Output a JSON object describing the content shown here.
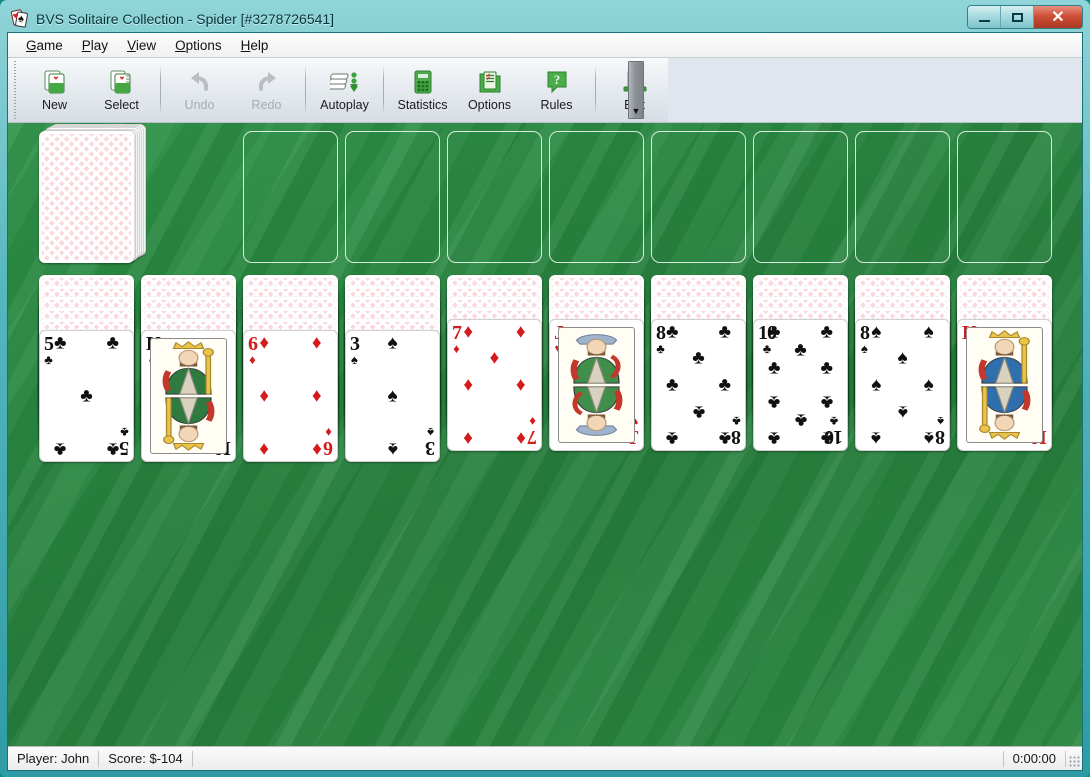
{
  "window": {
    "title": "BVS Solitaire Collection  -  Spider [#3278726541]",
    "app_icon": "cards-icon",
    "buttons": {
      "minimize": "minimize-icon",
      "maximize": "maximize-icon",
      "close": "✕"
    }
  },
  "menubar": {
    "items": [
      {
        "label": "Game",
        "accel": "G"
      },
      {
        "label": "Play",
        "accel": "P"
      },
      {
        "label": "View",
        "accel": "V"
      },
      {
        "label": "Options",
        "accel": "O"
      },
      {
        "label": "Help",
        "accel": "H"
      }
    ]
  },
  "toolbar": {
    "overflow_icon": "chevron-down-icon",
    "buttons": [
      {
        "label": "New",
        "icon": "new-game-icon",
        "enabled": true
      },
      {
        "label": "Select",
        "icon": "select-game-icon",
        "enabled": true
      },
      {
        "label": "Undo",
        "icon": "undo-icon",
        "enabled": false
      },
      {
        "label": "Redo",
        "icon": "redo-icon",
        "enabled": false
      },
      {
        "label": "Autoplay",
        "icon": "autoplay-icon",
        "enabled": true
      },
      {
        "label": "Statistics",
        "icon": "statistics-icon",
        "enabled": true
      },
      {
        "label": "Options",
        "icon": "options-icon",
        "enabled": true
      },
      {
        "label": "Rules",
        "icon": "rules-icon",
        "enabled": true
      },
      {
        "label": "Exit",
        "icon": "exit-icon",
        "enabled": true
      }
    ]
  },
  "table": {
    "felt_color": "#2a8a42",
    "stock": {
      "name": "stock-pile",
      "card_back": "pink-lattice",
      "visible_sheets": 7
    },
    "foundations": [
      {
        "name": "foundation-1",
        "empty": true
      },
      {
        "name": "foundation-2",
        "empty": true
      },
      {
        "name": "foundation-3",
        "empty": true
      },
      {
        "name": "foundation-4",
        "empty": true
      },
      {
        "name": "foundation-5",
        "empty": true
      },
      {
        "name": "foundation-6",
        "empty": true
      },
      {
        "name": "foundation-7",
        "empty": true
      },
      {
        "name": "foundation-8",
        "empty": true
      }
    ],
    "tableau": [
      {
        "column": 1,
        "facedown": 5,
        "top_card": {
          "rank": "5",
          "suit": "clubs",
          "suit_char": "♣",
          "color": "black",
          "court": false
        }
      },
      {
        "column": 2,
        "facedown": 5,
        "top_card": {
          "rank": "K",
          "suit": "clubs",
          "suit_char": "♣",
          "color": "black",
          "court": true
        }
      },
      {
        "column": 3,
        "facedown": 5,
        "top_card": {
          "rank": "6",
          "suit": "diamonds",
          "suit_char": "♦",
          "color": "red",
          "court": false
        }
      },
      {
        "column": 4,
        "facedown": 5,
        "top_card": {
          "rank": "3",
          "suit": "spades",
          "suit_char": "♠",
          "color": "black",
          "court": false
        }
      },
      {
        "column": 5,
        "facedown": 4,
        "top_card": {
          "rank": "7",
          "suit": "diamonds",
          "suit_char": "♦",
          "color": "red",
          "court": false
        }
      },
      {
        "column": 6,
        "facedown": 4,
        "top_card": {
          "rank": "J",
          "suit": "hearts",
          "suit_char": "♥",
          "color": "red",
          "court": true
        }
      },
      {
        "column": 7,
        "facedown": 4,
        "top_card": {
          "rank": "8",
          "suit": "clubs",
          "suit_char": "♣",
          "color": "black",
          "court": false
        }
      },
      {
        "column": 8,
        "facedown": 4,
        "top_card": {
          "rank": "10",
          "suit": "clubs",
          "suit_char": "♣",
          "color": "black",
          "court": false
        }
      },
      {
        "column": 9,
        "facedown": 4,
        "top_card": {
          "rank": "8",
          "suit": "spades",
          "suit_char": "♠",
          "color": "black",
          "court": false
        }
      },
      {
        "column": 10,
        "facedown": 4,
        "top_card": {
          "rank": "K",
          "suit": "diamonds",
          "suit_char": "♦",
          "color": "red",
          "court": true
        }
      }
    ]
  },
  "statusbar": {
    "player": "Player: John",
    "score": "Score: $-104",
    "timer": "0:00:00",
    "grip": "resize-grip-icon"
  }
}
